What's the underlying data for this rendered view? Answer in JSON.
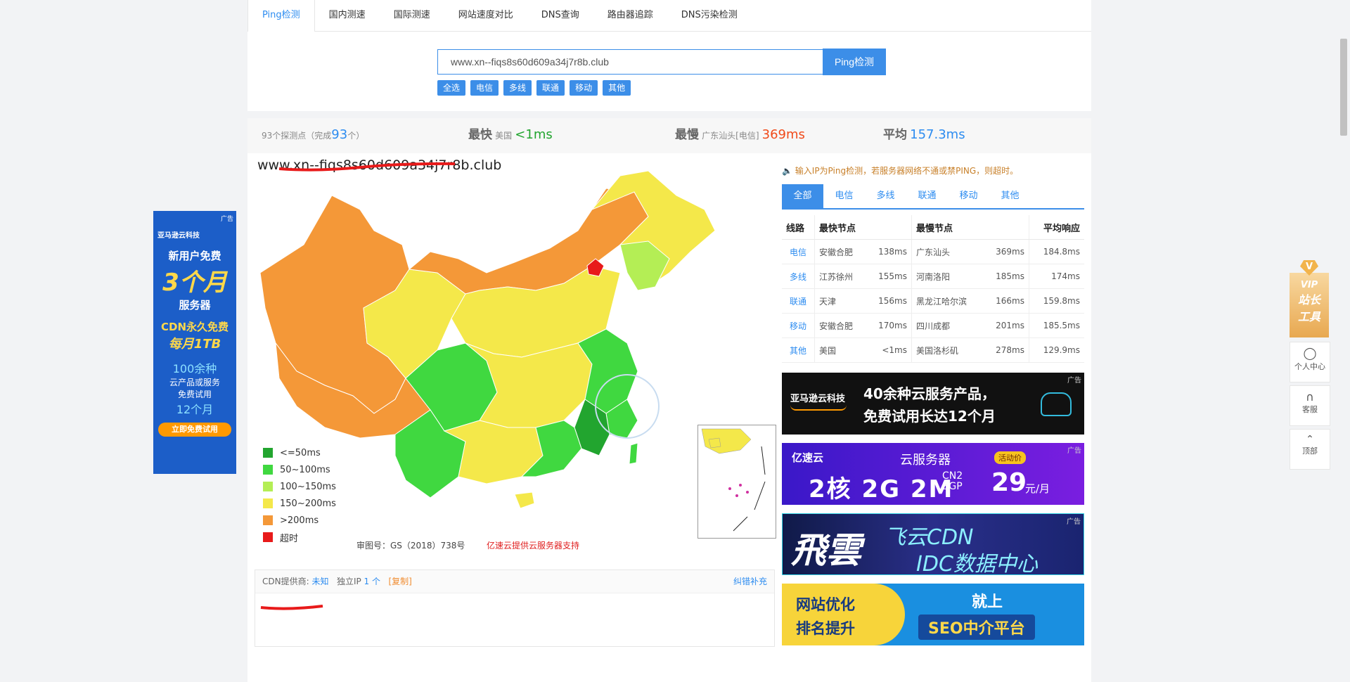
{
  "tabs": [
    "Ping检测",
    "国内测速",
    "国际测速",
    "网站速度对比",
    "DNS查询",
    "路由器追踪",
    "DNS污染检测"
  ],
  "search": {
    "value": "www.xn--fiqs8s60d609a34j7r8b.club",
    "button": "Ping检测"
  },
  "filters": [
    "全选",
    "电信",
    "多线",
    "联通",
    "移动",
    "其他"
  ],
  "stats": {
    "points_prefix": "93个探测点（完成",
    "points_done": "93",
    "points_suffix": "个）",
    "fastest_label": "最快",
    "fastest_loc": "美国",
    "fastest_val": "<1ms",
    "slowest_label": "最慢",
    "slowest_loc": "广东汕头[电信]",
    "slowest_val": "369ms",
    "avg_label": "平均",
    "avg_val": "157.3ms"
  },
  "map": {
    "title": "www.xn--fiqs8s60d609a34j7r8b.club",
    "legend": [
      {
        "label": "<=50ms",
        "color": "#22a52f"
      },
      {
        "label": "50~100ms",
        "color": "#40d840"
      },
      {
        "label": "100~150ms",
        "color": "#b4ee55"
      },
      {
        "label": "150~200ms",
        "color": "#f4e84a"
      },
      {
        "label": ">200ms",
        "color": "#f49838"
      },
      {
        "label": "超时",
        "color": "#e81a1a"
      }
    ],
    "approval": "审图号：GS（2018）738号",
    "support": "亿速云提供云服务器支持"
  },
  "cdn": {
    "label": "CDN提供商:",
    "value": "未知",
    "ip_label": "独立IP",
    "ip_count": "1 个",
    "copy": "[复制]",
    "report": "纠错补充"
  },
  "notice": "输入IP为Ping检测，若服务器网络不通或禁PING，则超时。",
  "result_tabs": [
    "全部",
    "电信",
    "多线",
    "联通",
    "移动",
    "其他"
  ],
  "table": {
    "headers": [
      "线路",
      "最快节点",
      "最慢节点",
      "平均响应"
    ],
    "rows": [
      {
        "line": "电信",
        "fast": "安徽合肥",
        "fast_ms": "138ms",
        "slow": "广东汕头",
        "slow_ms": "369ms",
        "avg": "184.8ms"
      },
      {
        "line": "多线",
        "fast": "江苏徐州",
        "fast_ms": "155ms",
        "slow": "河南洛阳",
        "slow_ms": "185ms",
        "avg": "174ms"
      },
      {
        "line": "联通",
        "fast": "天津",
        "fast_ms": "156ms",
        "slow": "黑龙江哈尔滨",
        "slow_ms": "166ms",
        "avg": "159.8ms"
      },
      {
        "line": "移动",
        "fast": "安徽合肥",
        "fast_ms": "170ms",
        "slow": "四川成都",
        "slow_ms": "201ms",
        "avg": "185.5ms"
      },
      {
        "line": "其他",
        "fast": "美国",
        "fast_ms": "<1ms",
        "slow": "美国洛杉矶",
        "slow_ms": "278ms",
        "avg": "129.9ms"
      }
    ]
  },
  "ads": {
    "tag": "广告",
    "amazon_brand": "亚马逊云科技",
    "amazon_line1": "40余种云服务产品，",
    "amazon_line2": "免费试用长达12个月",
    "yisu_brand": "亿速云",
    "yisu_product": "云服务器",
    "yisu_badge": "活动价",
    "yisu_spec": "2核 2G 2M",
    "yisu_net": "CN2 BGP",
    "yisu_price": "29",
    "yisu_unit": "元/月",
    "feiyun_logo": "飛雲",
    "feiyun_line1": "飞云CDN",
    "feiyun_line2": "IDC数据中心",
    "seo_left1": "网站优化",
    "seo_left2": "排名提升",
    "seo_right1": "就上",
    "seo_right2": "SEO中介平台"
  },
  "left_ad": {
    "tag": "广告",
    "brand": "亚马逊云科技",
    "l1": "新用户免费",
    "l2": "3个月",
    "l3": "服务器",
    "l4": "CDN永久免费",
    "l5": "每月1TB",
    "l6": "100余种",
    "l7": "云产品或服务",
    "l8": "免费试用",
    "l9": "12个月",
    "btn": "立即免费试用"
  },
  "side": {
    "vip1": "VIP",
    "vip2": "站长",
    "vip3": "工具",
    "user": "个人中心",
    "service": "客服",
    "top": "顶部"
  }
}
